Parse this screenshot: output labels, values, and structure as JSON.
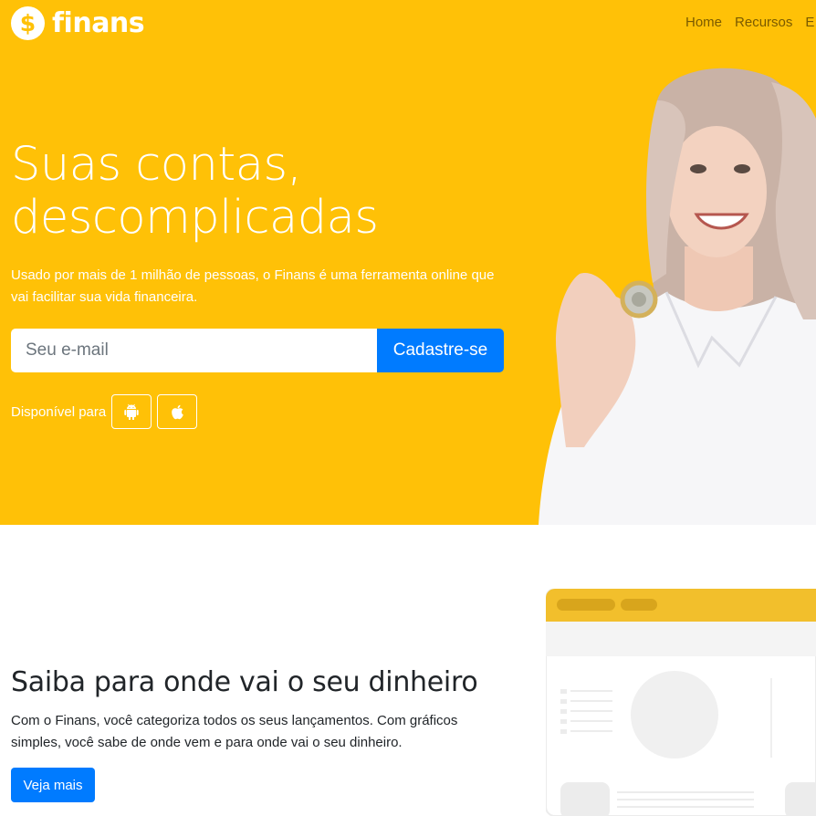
{
  "brand": {
    "logo_symbol": "$",
    "name": "finans",
    "color": "#ffc107"
  },
  "nav": {
    "items": [
      {
        "label": "Home"
      },
      {
        "label": "Recursos"
      },
      {
        "label": "E"
      }
    ]
  },
  "hero": {
    "title_line1": "Suas contas,",
    "title_line2": "descomplicadas",
    "subtitle": "Usado por mais de 1 milhão de pessoas, o Finans é uma ferramenta online que vai facilitar sua vida financeira.",
    "email_placeholder": "Seu e-mail",
    "email_value": "",
    "signup_label": "Cadastre-se",
    "available_label": "Disponível para",
    "stores": [
      {
        "icon": "android-icon"
      },
      {
        "icon": "apple-icon"
      }
    ]
  },
  "feature": {
    "title": "Saiba para onde vai o seu dinheiro",
    "text": "Com o Finans, você categoriza todos os seus lançamentos. Com gráficos simples, você sabe de onde vem e para onde vai o seu dinheiro.",
    "button_label": "Veja mais"
  },
  "colors": {
    "accent": "#ffc107",
    "primary": "#007bff",
    "white": "#ffffff"
  }
}
